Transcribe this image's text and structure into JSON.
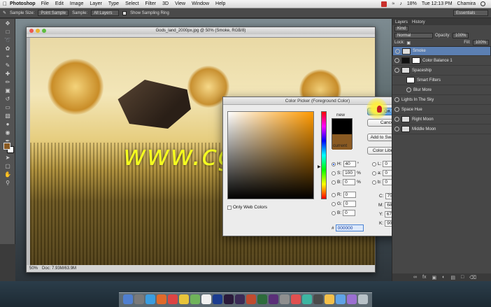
{
  "menubar": {
    "app_name": "Photoshop",
    "items": [
      "File",
      "Edit",
      "Image",
      "Layer",
      "Type",
      "Select",
      "Filter",
      "3D",
      "View",
      "Window",
      "Help"
    ],
    "battery": "18%",
    "clock": "Tue 12:13 PM",
    "user": "Chamira"
  },
  "options_bar": {
    "sample_size_label": "Sample Size:",
    "sample_size_value": "Point Sample",
    "sample_label": "Sample:",
    "sample_value": "All Layers",
    "ring_label": "Show Sampling Ring",
    "workspace": "Essentials"
  },
  "document": {
    "title": "Gods_land_2000px.jpg @ 50% (Smoke, RGB/8)",
    "zoom": "50%",
    "doc_info": "Doc: 7.93M/63.9M"
  },
  "color_picker": {
    "title": "Color Picker (Foreground Color)",
    "new_label": "new",
    "current_label": "current",
    "ok_label": "OK",
    "cancel_label": "Cancel",
    "add_swatches_label": "Add to Swatches",
    "libraries_label": "Color Libraries",
    "web_only_label": "Only Web Colors",
    "fields": {
      "H": {
        "label": "H:",
        "value": "40",
        "unit": "°"
      },
      "S": {
        "label": "S:",
        "value": "100",
        "unit": "%"
      },
      "B": {
        "label": "B:",
        "value": "0",
        "unit": "%"
      },
      "R": {
        "label": "R:",
        "value": "0"
      },
      "G": {
        "label": "G:",
        "value": "0"
      },
      "Bl": {
        "label": "B:",
        "value": "0"
      },
      "L": {
        "label": "L:",
        "value": "0"
      },
      "a": {
        "label": "a:",
        "value": "0"
      },
      "b": {
        "label": "b:",
        "value": "0"
      },
      "C": {
        "label": "C:",
        "value": "75",
        "unit": "%"
      },
      "M": {
        "label": "M:",
        "value": "68",
        "unit": "%"
      },
      "Y": {
        "label": "Y:",
        "value": "67",
        "unit": "%"
      },
      "K": {
        "label": "K:",
        "value": "90",
        "unit": "%"
      }
    },
    "hex_label": "#",
    "hex_value": "000000"
  },
  "watermark": "www.cgtsj.com",
  "panels": {
    "tabs": [
      "Layers",
      "History"
    ],
    "kind_label": "Kind",
    "blend_mode": "Normal",
    "opacity_label": "Opacity:",
    "opacity_value": "100%",
    "lock_label": "Lock:",
    "fill_label": "Fill:",
    "fill_value": "100%",
    "layers": [
      "Smoke",
      "Color Balance 1",
      "Spaceship",
      "Smart Filters",
      "Blur More",
      "Lights In The Sky",
      "Space Hue",
      "Right Moon",
      "Middle Moon"
    ]
  },
  "colors": {
    "foreground": "#8a5a22",
    "new_color": "#000000",
    "accent": "#4f9ae0"
  }
}
